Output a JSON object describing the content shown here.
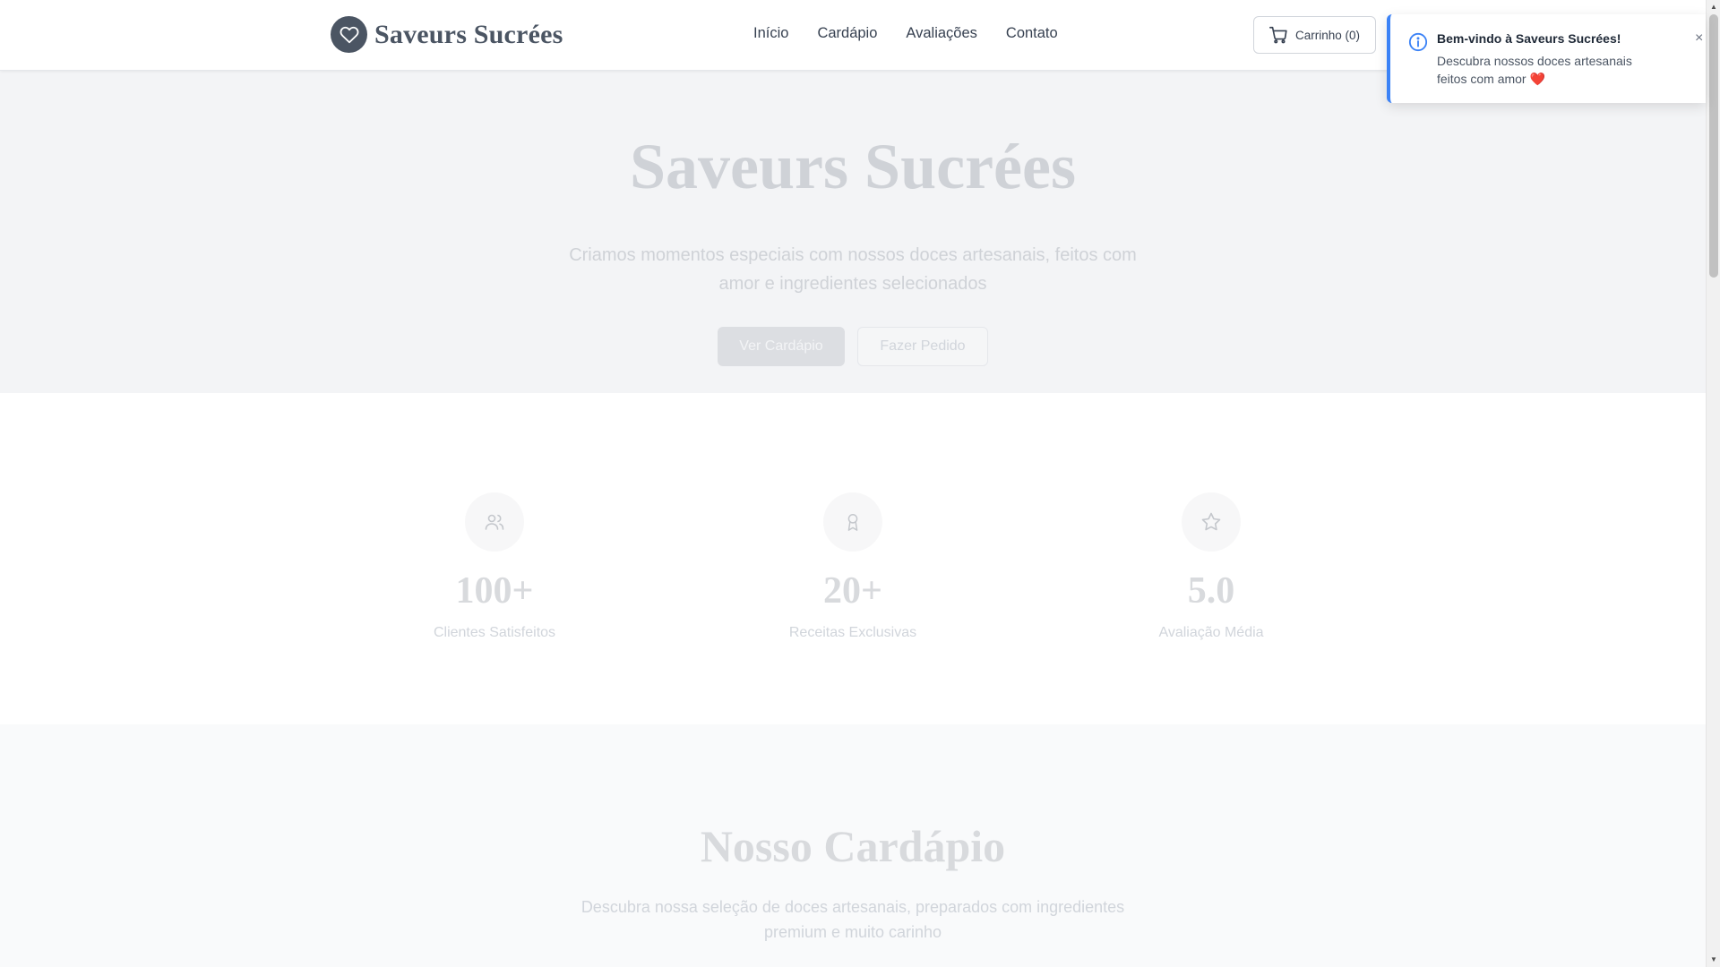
{
  "header": {
    "brand": "Saveurs Sucrées",
    "nav": [
      "Início",
      "Cardápio",
      "Avaliações",
      "Contato"
    ],
    "cart_label": "Carrinho (0)"
  },
  "hero": {
    "title": "Saveurs Sucrées",
    "subtitle": "Criamos momentos especiais com nossos doces artesanais, feitos com amor e ingredientes selecionados",
    "primary_button": "Ver Cardápio",
    "secondary_button": "Fazer Pedido"
  },
  "stats": [
    {
      "value": "100+",
      "label": "Clientes Satisfeitos",
      "icon": "users-icon"
    },
    {
      "value": "20+",
      "label": "Receitas Exclusivas",
      "icon": "award-icon"
    },
    {
      "value": "5.0",
      "label": "Avaliação Média",
      "icon": "star-icon"
    }
  ],
  "menu": {
    "title": "Nosso Cardápio",
    "subtitle": "Descubra nossa seleção de doces artesanais, preparados com ingredientes premium e muito carinho"
  },
  "toast": {
    "title": "Bem-vindo à Saveurs Sucrées!",
    "message": "Descubra nossos doces artesanais feitos com amor ❤️",
    "close": "×"
  },
  "colors": {
    "accent": "#3b82f6",
    "brand": "#4b5563"
  }
}
